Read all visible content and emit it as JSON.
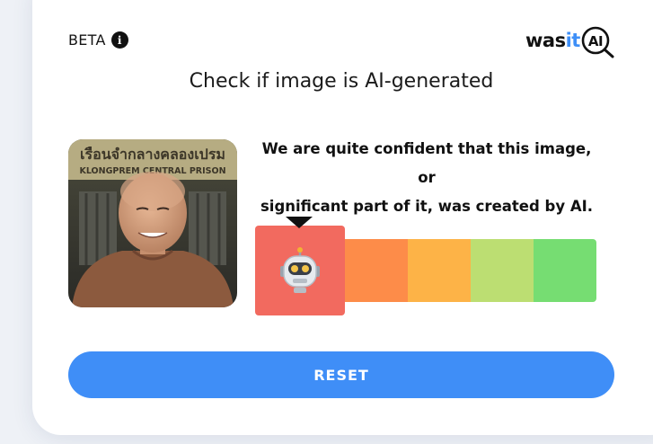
{
  "header": {
    "beta_label": "BETA",
    "info_icon": "info-icon",
    "logo": {
      "prefix": "was",
      "accent": "it",
      "suffix": "AI"
    }
  },
  "title": "Check if image is AI-generated",
  "photo": {
    "sign_text": "KLONGPREM CENTRAL PRISON"
  },
  "verdict": {
    "line1": "We are quite confident that this image, or",
    "line2": "significant part of it, was created by AI."
  },
  "meter": {
    "active_index": 0,
    "active_icon": "robot-icon",
    "segments": [
      "#f26a5f",
      "#fd8c49",
      "#fdb347",
      "#bcde72",
      "#76dd72"
    ]
  },
  "reset_label": "RESET",
  "colors": {
    "accent": "#3f8ef7",
    "text": "#111111"
  }
}
